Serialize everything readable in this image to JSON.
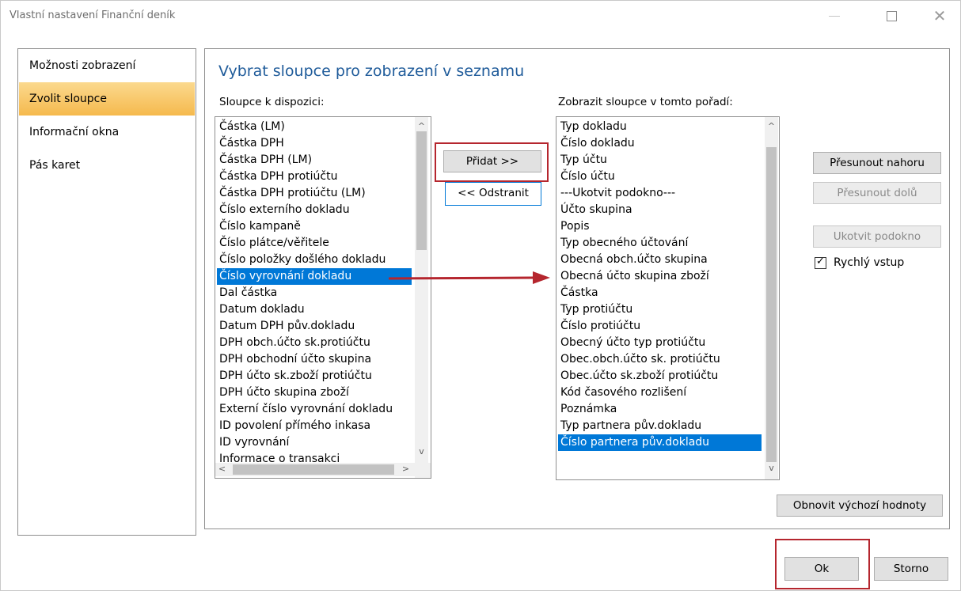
{
  "window": {
    "title": "Vlastní nastavení Finanční deník"
  },
  "nav": {
    "items": [
      {
        "label": "Možnosti zobrazení",
        "active": false
      },
      {
        "label": "Zvolit sloupce",
        "active": true
      },
      {
        "label": "Informační okna",
        "active": false
      },
      {
        "label": "Pás karet",
        "active": false
      }
    ]
  },
  "panel": {
    "title": "Vybrat sloupce pro zobrazení v seznamu",
    "available_label": "Sloupce k dispozici:",
    "shown_label": "Zobrazit sloupce v tomto pořadí:",
    "available_columns": [
      "Částka (LM)",
      "Částka DPH",
      "Částka DPH (LM)",
      "Částka DPH protiúčtu",
      "Částka DPH protiúčtu (LM)",
      "Číslo externího dokladu",
      "Číslo kampaně",
      "Číslo plátce/věřitele",
      "Číslo položky došlého dokladu",
      "Číslo vyrovnání dokladu",
      "Dal částka",
      "Datum dokladu",
      "Datum DPH pův.dokladu",
      "DPH obch.účto sk.protiúčtu",
      "DPH obchodní účto skupina",
      "DPH účto sk.zboží protiúčtu",
      "DPH účto skupina zboží",
      "Externí číslo vyrovnání dokladu",
      "ID povolení přímého inkasa",
      "ID vyrovnání",
      "Informace o transakci"
    ],
    "available_selected_index": 9,
    "shown_columns": [
      "Typ dokladu",
      "Číslo dokladu",
      "Typ účtu",
      "Číslo účtu",
      "---Ukotvit podokno---",
      "Účto skupina",
      "Popis",
      "Typ obecného účtování",
      "Obecná obch.účto skupina",
      "Obecná účto skupina zboží",
      "Částka",
      "Typ protiúčtu",
      "Číslo protiúčtu",
      "Obecný účto typ protiúčtu",
      "Obec.obch.účto sk. protiúčtu",
      "Obec.účto sk.zboží protiúčtu",
      "Kód časového rozlišení",
      "Poznámka",
      "Typ partnera pův.dokladu",
      "Číslo partnera pův.dokladu"
    ],
    "shown_selected_index": 19,
    "add_button": "Přidat >>",
    "remove_button": "<< Odstranit",
    "move_up_button": "Přesunout nahoru",
    "move_down_button": "Přesunout dolů",
    "freeze_button": "Ukotvit podokno",
    "quick_entry_label": "Rychlý vstup",
    "quick_entry_checked": true,
    "reset_button": "Obnovit výchozí hodnoty"
  },
  "footer": {
    "ok_button": "Ok",
    "cancel_button": "Storno"
  },
  "colors": {
    "selection": "#0078d7",
    "title": "#1f5b9a",
    "annotation": "#b5262e"
  }
}
